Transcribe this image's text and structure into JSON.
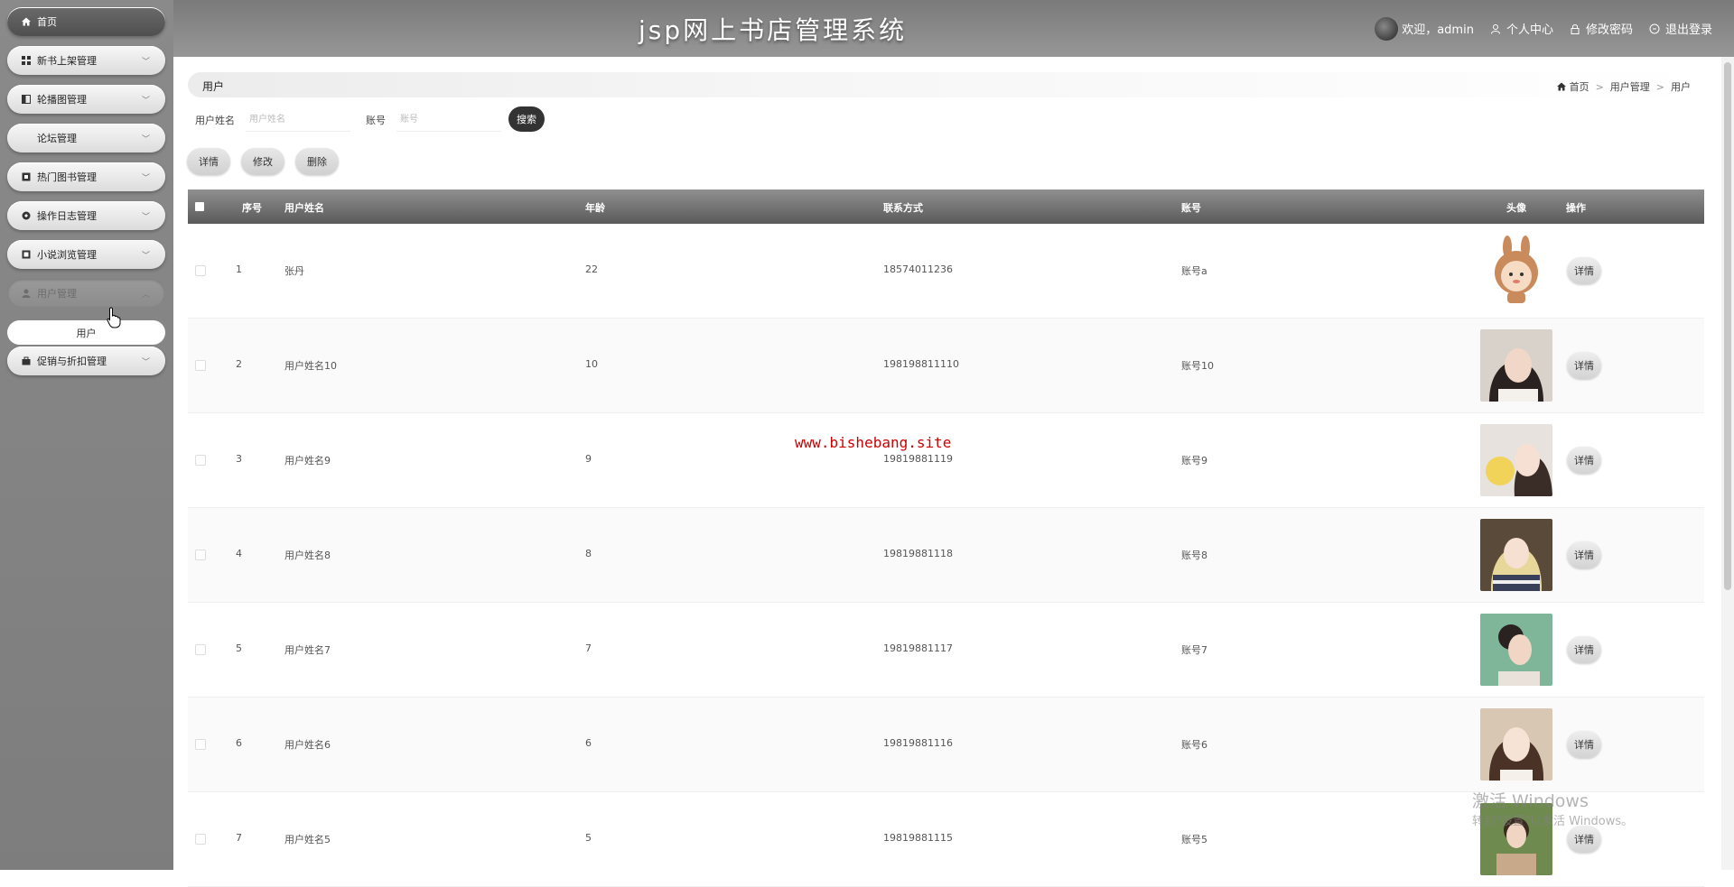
{
  "app": {
    "title": "jsp网上书店管理系统",
    "welcome": "欢迎，admin",
    "profile_link": "个人中心",
    "change_password_link": "修改密码",
    "logout_link": "退出登录"
  },
  "sidebar": {
    "items": [
      {
        "label": "首页",
        "icon": "home-icon"
      },
      {
        "label": "新书上架管理",
        "icon": "grid-icon"
      },
      {
        "label": "轮播图管理",
        "icon": "image-icon"
      },
      {
        "label": "论坛管理",
        "icon": ""
      },
      {
        "label": "热门图书管理",
        "icon": "book-icon"
      },
      {
        "label": "操作日志管理",
        "icon": "log-icon"
      },
      {
        "label": "小说浏览管理",
        "icon": "novel-icon"
      },
      {
        "label": "用户管理",
        "icon": "user-icon"
      },
      {
        "label": "促销与折扣管理",
        "icon": "discount-icon"
      }
    ],
    "submenu": {
      "label": "用户"
    }
  },
  "page": {
    "title": "用户",
    "breadcrumb": [
      "首页",
      "用户管理",
      "用户"
    ]
  },
  "search": {
    "name_label": "用户姓名",
    "name_placeholder": "用户姓名",
    "account_label": "账号",
    "account_placeholder": "账号",
    "button": "搜索"
  },
  "actions": {
    "detail": "详情",
    "edit": "修改",
    "delete": "删除"
  },
  "table": {
    "columns": [
      "序号",
      "用户姓名",
      "年龄",
      "联系方式",
      "账号",
      "头像",
      "操作"
    ],
    "detail_label": "详情",
    "rows": [
      {
        "no": "1",
        "name": "张丹",
        "age": "22",
        "phone": "18574011236",
        "account": "账号a"
      },
      {
        "no": "2",
        "name": "用户姓名10",
        "age": "10",
        "phone": "198198811110",
        "account": "账号10"
      },
      {
        "no": "3",
        "name": "用户姓名9",
        "age": "9",
        "phone": "19819881119",
        "account": "账号9"
      },
      {
        "no": "4",
        "name": "用户姓名8",
        "age": "8",
        "phone": "19819881118",
        "account": "账号8"
      },
      {
        "no": "5",
        "name": "用户姓名7",
        "age": "7",
        "phone": "19819881117",
        "account": "账号7"
      },
      {
        "no": "6",
        "name": "用户姓名6",
        "age": "6",
        "phone": "19819881116",
        "account": "账号6"
      },
      {
        "no": "7",
        "name": "用户姓名5",
        "age": "5",
        "phone": "19819881115",
        "account": "账号5"
      }
    ]
  },
  "overlay": {
    "watermark": "www.bishebang.site",
    "windows_activate": "激活 Windows",
    "windows_activate_sub": "转到\"设置\"以激活 Windows。"
  }
}
